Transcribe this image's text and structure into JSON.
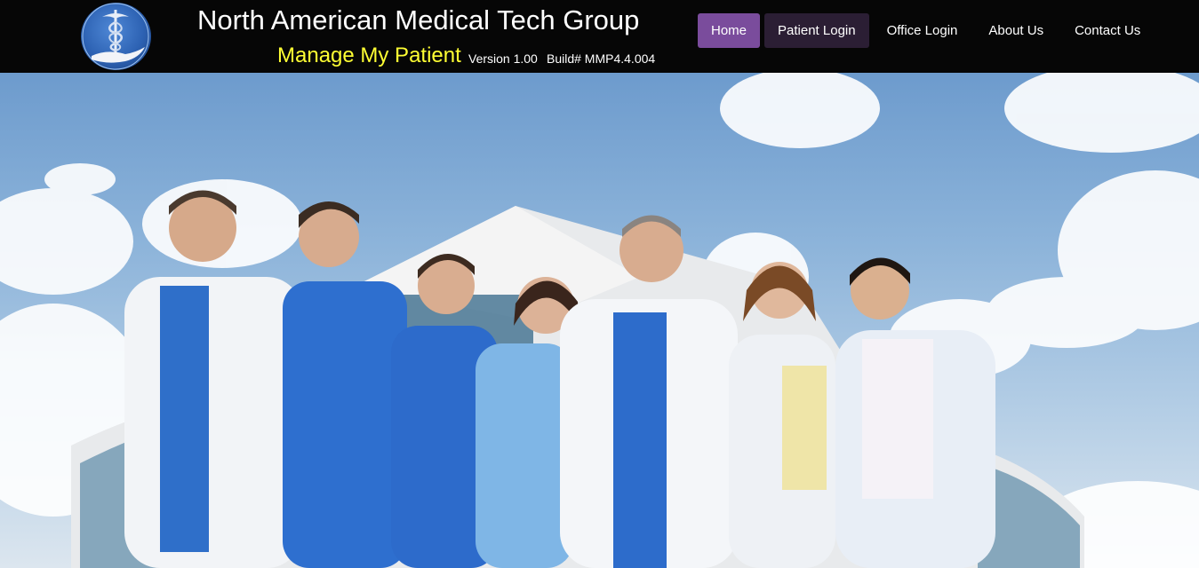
{
  "header": {
    "title": "North American Medical Tech Group",
    "subtitle": "Manage My Patient",
    "version": "Version 1.00",
    "build": "Build# MMP4.4.004",
    "logo_icon": "caduceus-hand-icon"
  },
  "nav": {
    "items": [
      {
        "label": "Home",
        "state": "active"
      },
      {
        "label": "Patient Login",
        "state": "hover"
      },
      {
        "label": "Office Login",
        "state": "normal"
      },
      {
        "label": "About Us",
        "state": "normal"
      },
      {
        "label": "Contact Us",
        "state": "normal"
      }
    ]
  },
  "colors": {
    "header_bg": "#060606",
    "accent_active": "#7a4c9c",
    "accent_hover": "#2b1e34",
    "title": "#ffffff",
    "subtitle": "#ffff33"
  }
}
